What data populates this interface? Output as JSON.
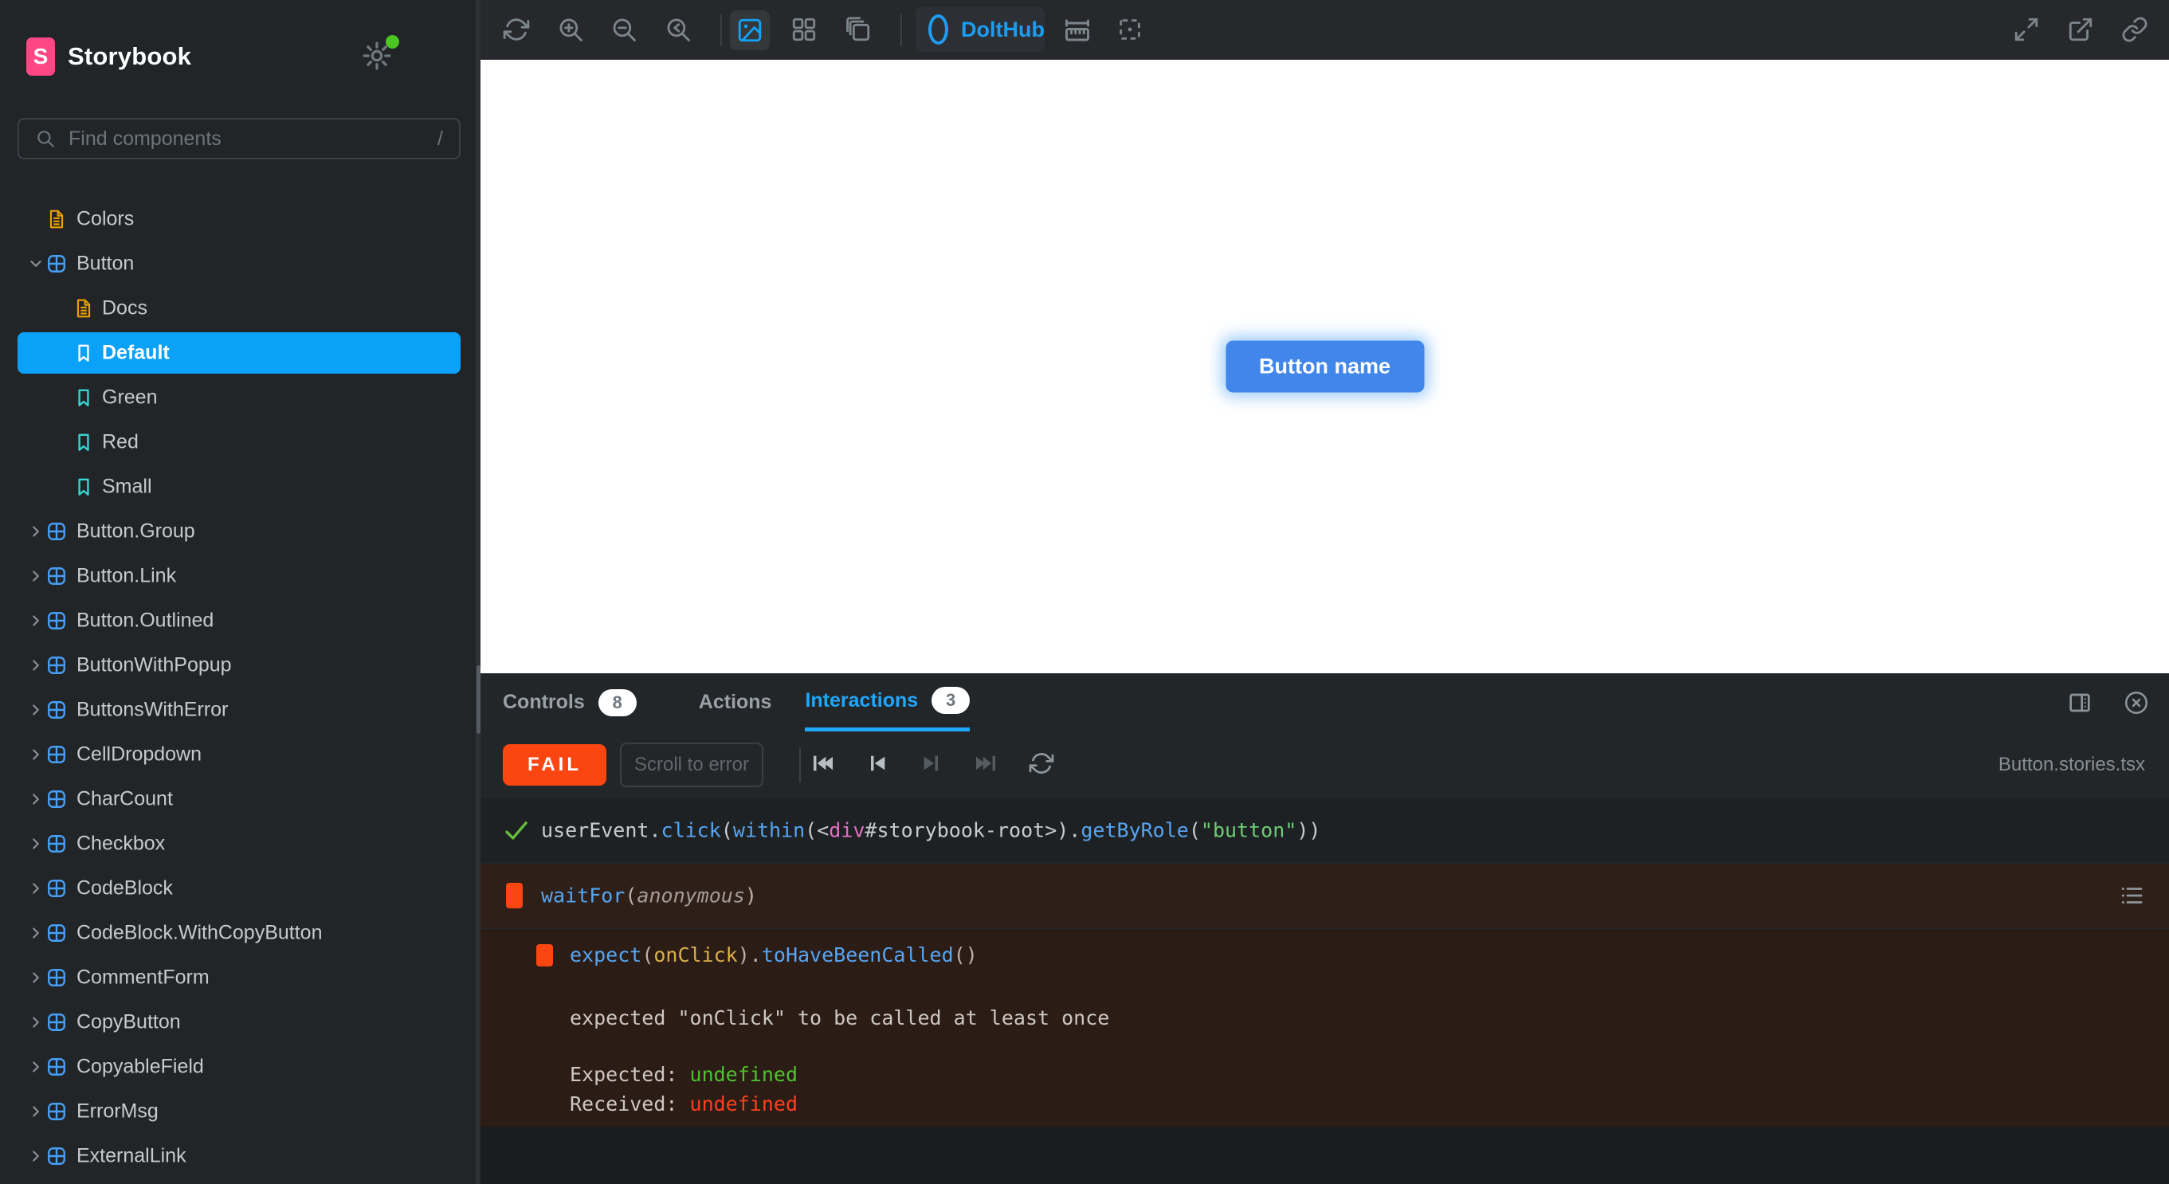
{
  "app": {
    "brand": "Storybook"
  },
  "colors": {
    "brand_pink": "#FF4785",
    "accent_blue": "#0AA1F8",
    "tab_active_blue": "#1EA7FD",
    "dolthub_blue": "#1D9DF2",
    "component_blue": "#479FF7",
    "doc_orange": "#EBA000",
    "story_teal": "#37D5D3",
    "fail_orange": "#FC4612",
    "pass_green": "#66BF3C",
    "expected_green": "#4EC22D",
    "received_red": "#FD3F1C",
    "canvas_button_blue": "#4186EA"
  },
  "sidebar": {
    "search": {
      "placeholder": "Find components",
      "shortcut": "/"
    },
    "items": [
      {
        "label": "Colors",
        "icon": "document",
        "level": 0
      },
      {
        "label": "Button",
        "icon": "component",
        "level": 0,
        "state": "expanded"
      },
      {
        "label": "Docs",
        "icon": "document",
        "level": 1
      },
      {
        "label": "Default",
        "icon": "story",
        "level": 1,
        "selected": true
      },
      {
        "label": "Green",
        "icon": "story",
        "level": 1
      },
      {
        "label": "Red",
        "icon": "story",
        "level": 1
      },
      {
        "label": "Small",
        "icon": "story",
        "level": 1
      },
      {
        "label": "Button.Group",
        "icon": "component",
        "level": 0
      },
      {
        "label": "Button.Link",
        "icon": "component",
        "level": 0
      },
      {
        "label": "Button.Outlined",
        "icon": "component",
        "level": 0
      },
      {
        "label": "ButtonWithPopup",
        "icon": "component",
        "level": 0
      },
      {
        "label": "ButtonsWithError",
        "icon": "component",
        "level": 0
      },
      {
        "label": "CellDropdown",
        "icon": "component",
        "level": 0
      },
      {
        "label": "CharCount",
        "icon": "component",
        "level": 0
      },
      {
        "label": "Checkbox",
        "icon": "component",
        "level": 0
      },
      {
        "label": "CodeBlock",
        "icon": "component",
        "level": 0
      },
      {
        "label": "CodeBlock.WithCopyButton",
        "icon": "component",
        "level": 0
      },
      {
        "label": "CommentForm",
        "icon": "component",
        "level": 0
      },
      {
        "label": "CopyButton",
        "icon": "component",
        "level": 0
      },
      {
        "label": "CopyableField",
        "icon": "component",
        "level": 0
      },
      {
        "label": "ErrorMsg",
        "icon": "component",
        "level": 0
      },
      {
        "label": "ExternalLink",
        "icon": "component",
        "level": 0
      }
    ]
  },
  "toolbar": {
    "icons": [
      "sync",
      "zoom-in",
      "zoom-out",
      "zoom-reset",
      "canvas-view",
      "grid-view",
      "docs-view",
      "measure",
      "outline",
      "fullscreen",
      "open-external",
      "copy-link"
    ],
    "addon": {
      "label": "DoltHub",
      "icon": "ring"
    }
  },
  "canvas": {
    "button_label": "Button name"
  },
  "panel": {
    "tabs": [
      {
        "label": "Controls",
        "badge": "8"
      },
      {
        "label": "Actions",
        "badge": ""
      },
      {
        "label": "Interactions",
        "badge": "3",
        "active": true
      }
    ],
    "icons": [
      "panel-position",
      "close"
    ],
    "toolbar": {
      "status": "FAIL",
      "scroll_to_error": "Scroll to error",
      "playback": [
        "go-first",
        "go-back",
        "go-forward",
        "go-last",
        "rerun"
      ],
      "file": "Button.stories.tsx"
    },
    "steps": {
      "step1": {
        "t1": "userEvent.",
        "t2": "click",
        "t3": "(",
        "t4": "within",
        "t5": "(<",
        "t6": "div",
        "t7": "#storybook-root",
        "t8": ">).",
        "t9": "getByRole",
        "t10": "(",
        "t11": "\"button\"",
        "t12": "))",
        "status": "pass"
      },
      "step2": {
        "t1": "waitFor",
        "t2": "(",
        "t3": "anonymous",
        "t4": ")",
        "status": "fail"
      },
      "step3": {
        "t1": "expect",
        "t2": "(",
        "t3": "onClick",
        "t4": ").",
        "t5": "toHaveBeenCalled",
        "t6": "()",
        "status": "fail"
      }
    },
    "error": {
      "message": "expected \"onClick\" to be called at least once",
      "expected_label": "Expected:",
      "expected_value": "undefined",
      "received_label": "Received:",
      "received_value": "undefined"
    }
  }
}
